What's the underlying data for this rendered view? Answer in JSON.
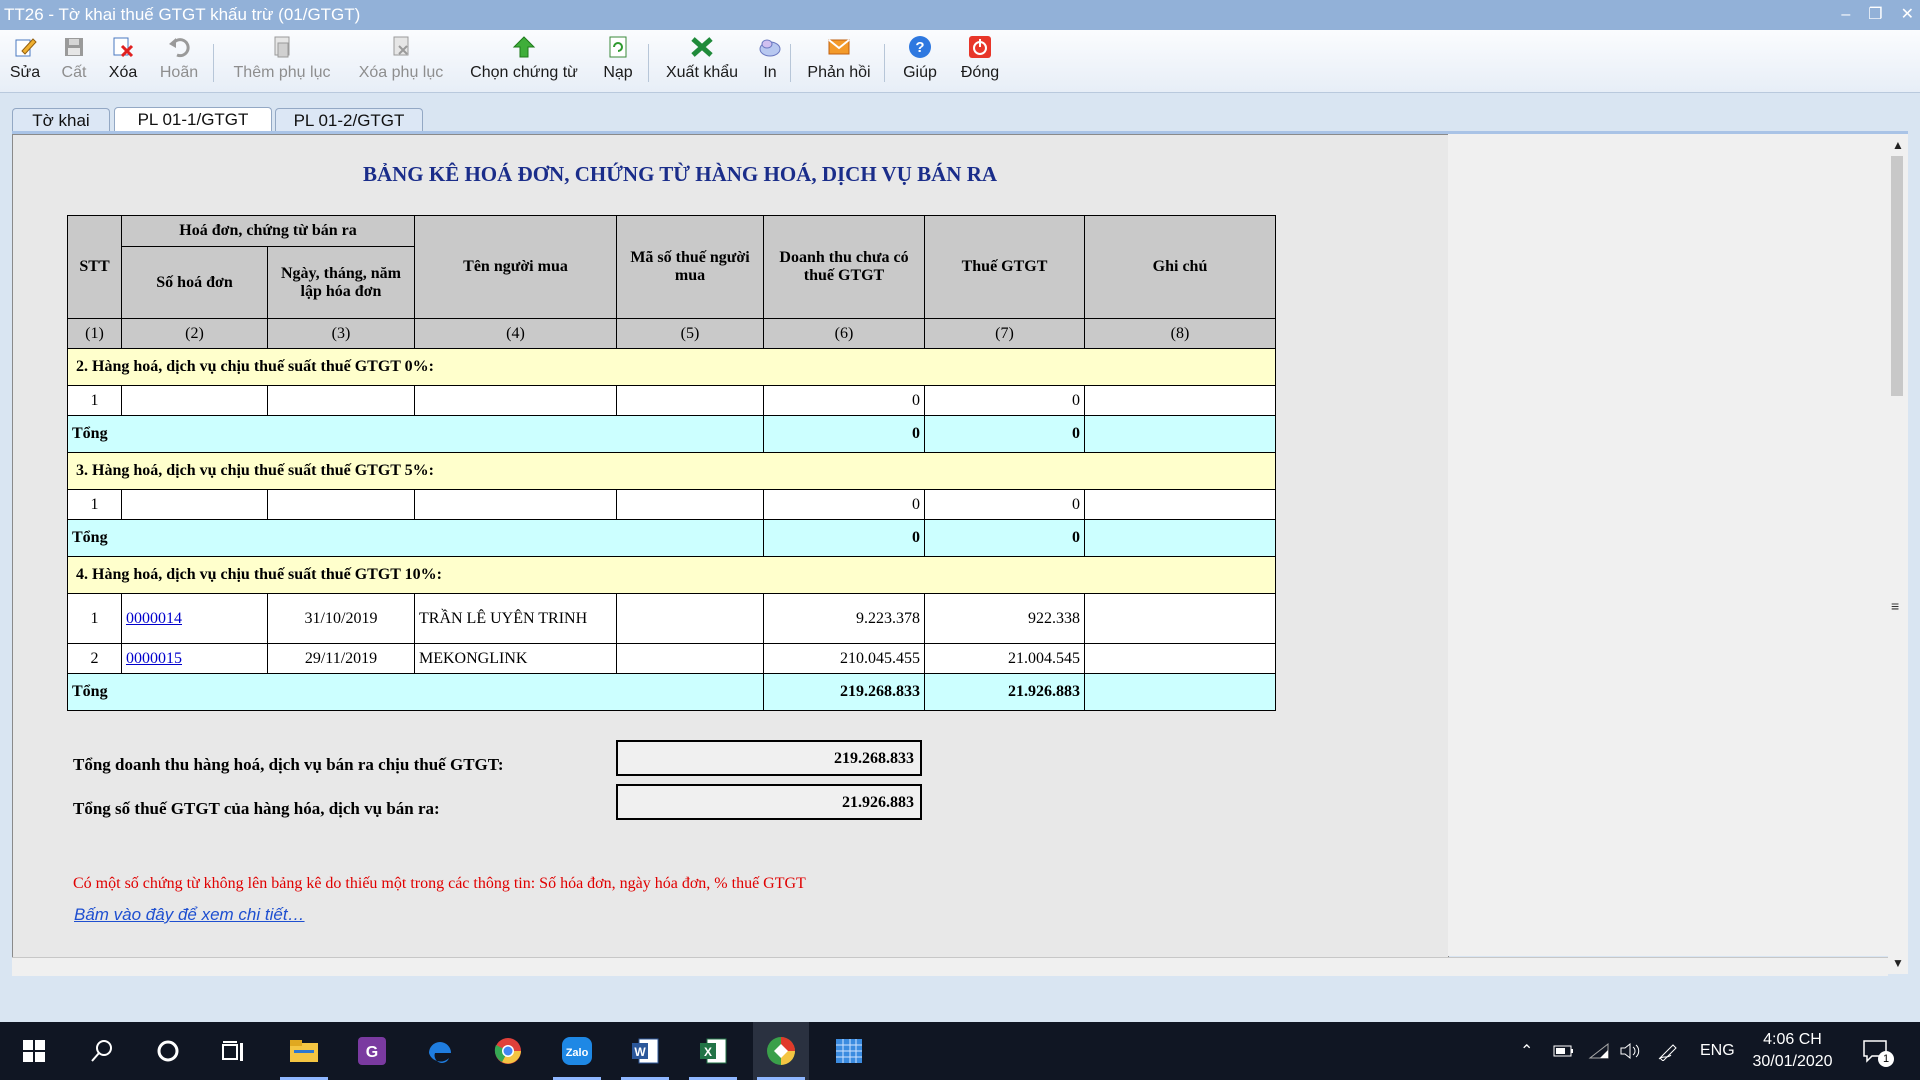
{
  "window": {
    "title": "TT26 - Tờ khai thuế GTGT khấu trừ (01/GTGT)"
  },
  "toolbar": {
    "edit": "Sửa",
    "save": "Cất",
    "delete": "Xóa",
    "undo": "Hoãn",
    "add_appendix": "Thêm phụ lục",
    "delete_appendix": "Xóa phụ lục",
    "choose_docs": "Chọn chứng từ",
    "load": "Nạp",
    "export": "Xuất khẩu",
    "print": "In",
    "feedback": "Phản hồi",
    "help": "Giúp",
    "close": "Đóng"
  },
  "tabs": [
    "Tờ khai",
    "PL 01-1/GTGT",
    "PL 01-2/GTGT"
  ],
  "report": {
    "title": "BẢNG KÊ HOÁ ĐƠN, CHỨNG TỪ HÀNG HOÁ, DỊCH VỤ BÁN RA",
    "headers": {
      "stt": "STT",
      "invoice_group": "Hoá đơn, chứng từ bán ra",
      "invoice_no": "Số hoá đơn",
      "invoice_date": "Ngày, tháng, năm lập hóa đơn",
      "buyer_name": "Tên người mua",
      "buyer_tax": "Mã số thuế người mua",
      "revenue": "Doanh thu chưa có thuế GTGT",
      "vat": "Thuế GTGT",
      "note": "Ghi chú"
    },
    "col_numbers": [
      "(1)",
      "(2)",
      "(3)",
      "(4)",
      "(5)",
      "(6)",
      "(7)",
      "(8)"
    ],
    "total_label": "Tổng",
    "sections": [
      {
        "title": "2. Hàng hoá, dịch vụ chịu thuế suất thuế GTGT 0%:",
        "rows": [
          {
            "stt": "1",
            "invoice_no": "",
            "date": "",
            "buyer": "",
            "tax_code": "",
            "revenue": "0",
            "vat": "0",
            "note": ""
          }
        ],
        "total_revenue": "0",
        "total_vat": "0"
      },
      {
        "title": "3. Hàng hoá, dịch vụ chịu thuế suất thuế GTGT 5%:",
        "rows": [
          {
            "stt": "1",
            "invoice_no": "",
            "date": "",
            "buyer": "",
            "tax_code": "",
            "revenue": "0",
            "vat": "0",
            "note": ""
          }
        ],
        "total_revenue": "0",
        "total_vat": "0"
      },
      {
        "title": "4. Hàng hoá, dịch vụ chịu thuế suất thuế GTGT 10%:",
        "rows": [
          {
            "stt": "1",
            "invoice_no": "0000014",
            "date": "31/10/2019",
            "buyer": "TRẦN LÊ UYÊN TRINH",
            "tax_code": "",
            "revenue": "9.223.378",
            "vat": "922.338",
            "note": ""
          },
          {
            "stt": "2",
            "invoice_no": "0000015",
            "date": "29/11/2019",
            "buyer": "MEKONGLINK",
            "tax_code": "",
            "revenue": "210.045.455",
            "vat": "21.004.545",
            "note": ""
          }
        ],
        "total_revenue": "219.268.833",
        "total_vat": "21.926.883"
      }
    ],
    "sum_revenue_label": "Tổng doanh thu hàng hoá, dịch vụ bán ra chịu thuế GTGT:",
    "sum_revenue": "219.268.833",
    "sum_vat_label": "Tổng số thuế GTGT của hàng hóa, dịch vụ bán ra:",
    "sum_vat": "21.926.883",
    "warning": "Có một số chứng từ không lên bảng kê do thiếu một trong các thông tin: Số hóa đơn, ngày hóa đơn, % thuế GTGT",
    "detail_link": "Bấm vào đây để xem chi tiết…"
  },
  "taskbar": {
    "lang": "ENG",
    "time": "4:06 CH",
    "date": "30/01/2020",
    "notif_count": "1",
    "zalo": "Zalo"
  }
}
